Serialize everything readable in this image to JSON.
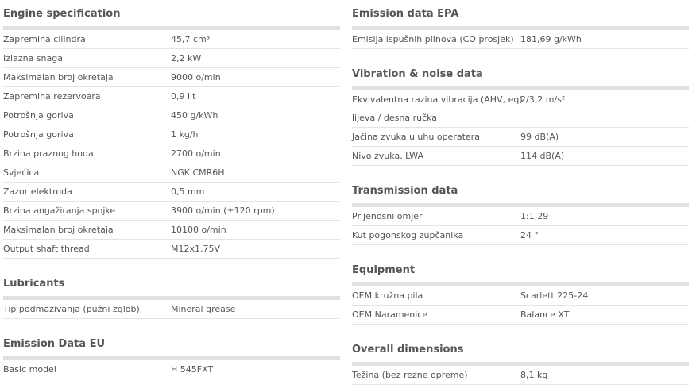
{
  "left": [
    {
      "title": "Engine specification",
      "rows": [
        {
          "label": "Zapremina cilindra",
          "value": "45,7 cm³"
        },
        {
          "label": "Izlazna snaga",
          "value": "2,2 kW"
        },
        {
          "label": "Maksimalan broj okretaja",
          "value": "9000 o/min"
        },
        {
          "label": "Zapremina rezervoara",
          "value": "0,9 lit"
        },
        {
          "label": "Potrošnja goriva",
          "value": "450 g/kWh"
        },
        {
          "label": "Potrošnja goriva",
          "value": "1 kg/h"
        },
        {
          "label": "Brzina praznog hoda",
          "value": "2700 o/min"
        },
        {
          "label": "Svjećica",
          "value": "NGK CMR6H"
        },
        {
          "label": "Zazor elektroda",
          "value": "0,5 mm"
        },
        {
          "label": "Brzina angažiranja spojke",
          "value": "3900 o/min (±120 rpm)"
        },
        {
          "label": "Maksimalan broj okretaja",
          "value": "10100 o/min"
        },
        {
          "label": "Output shaft thread",
          "value": "M12x1.75V"
        }
      ]
    },
    {
      "title": "Lubricants",
      "rows": [
        {
          "label": "Tip podmazivanja (pužni zglob)",
          "value": "Mineral grease"
        }
      ]
    },
    {
      "title": "Emission Data EU",
      "rows": [
        {
          "label": "Basic model",
          "value": "H 545FXT"
        }
      ]
    }
  ],
  "right": [
    {
      "title": "Emission data EPA",
      "rows": [
        {
          "label": "Emisija ispušnih plinova (CO prosjek)",
          "value": "181,69 g/kWh"
        }
      ]
    },
    {
      "title": "Vibration & noise data",
      "rows": [
        {
          "label": "Ekvivalentna razina vibracija (AHV, eq)",
          "value": "2/3,2 m/s²"
        },
        {
          "label": "lijeva / desna ručka",
          "value": ""
        },
        {
          "label": "Jačina zvuka u uhu operatera",
          "value": "99 dB(A)"
        },
        {
          "label": "Nivo zvuka, LWA",
          "value": "114 dB(A)"
        }
      ]
    },
    {
      "title": "Transmission data",
      "rows": [
        {
          "label": "Prijenosni omjer",
          "value": "1:1,29"
        },
        {
          "label": "Kut pogonskog zupčanika",
          "value": "24 °"
        }
      ]
    },
    {
      "title": "Equipment",
      "rows": [
        {
          "label": "OEM kružna pila",
          "value": "Scarlett 225-24"
        },
        {
          "label": "OEM Naramenice",
          "value": "Balance XT"
        }
      ]
    },
    {
      "title": "Overall dimensions",
      "rows": [
        {
          "label": "Težina (bez rezne opreme)",
          "value": "8,1 kg"
        }
      ]
    }
  ]
}
